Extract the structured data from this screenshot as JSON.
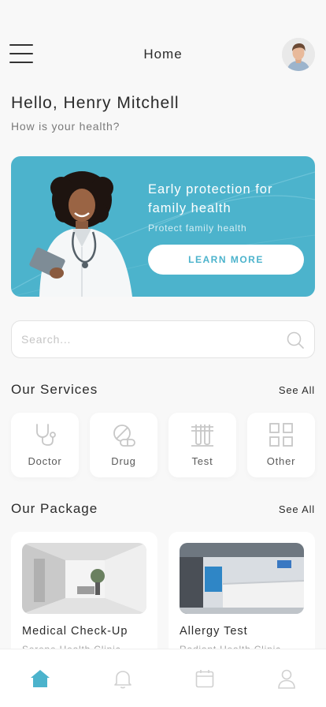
{
  "header": {
    "title": "Home",
    "menu_icon": "hamburger-menu-icon",
    "avatar_icon": "user-avatar"
  },
  "greeting": {
    "title": "Hello, Henry Mitchell",
    "subtitle": "How is your health?"
  },
  "banner": {
    "title": "Early protection for family health",
    "subtitle": "Protect family health",
    "button_label": "LEARN MORE",
    "background_color": "#4cb3cc"
  },
  "search": {
    "placeholder": "Search...",
    "value": "",
    "icon": "search-icon"
  },
  "services": {
    "title": "Our Services",
    "see_all": "See All",
    "items": [
      {
        "label": "Doctor",
        "icon": "stethoscope-icon"
      },
      {
        "label": "Drug",
        "icon": "pill-icon"
      },
      {
        "label": "Test",
        "icon": "test-tube-icon"
      },
      {
        "label": "Other",
        "icon": "grid-icon"
      }
    ]
  },
  "packages": {
    "title": "Our Package",
    "see_all": "See All",
    "items": [
      {
        "name": "Medical Check-Up",
        "clinic": "Serene Health Clinic"
      },
      {
        "name": "Allergy Test",
        "clinic": "Radiant Health Clinic"
      }
    ]
  },
  "bottom_nav": {
    "items": [
      {
        "icon": "home-icon",
        "active": true
      },
      {
        "icon": "bell-icon",
        "active": false
      },
      {
        "icon": "calendar-icon",
        "active": false
      },
      {
        "icon": "profile-icon",
        "active": false
      }
    ],
    "active_color": "#4cb3cc",
    "inactive_color": "#d0d0d0"
  }
}
